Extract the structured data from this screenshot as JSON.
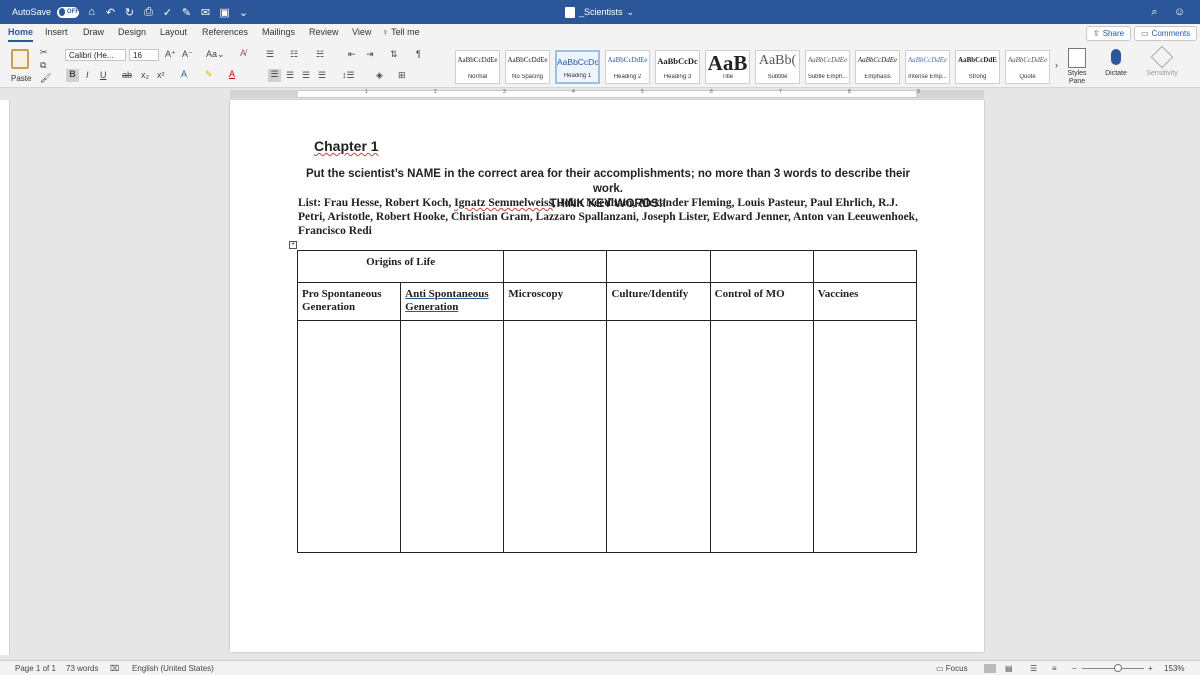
{
  "titlebar": {
    "autosave_label": "AutoSave",
    "autosave_state": "OFF",
    "document_title": "_Scientists"
  },
  "ribbon": {
    "tabs": [
      "Home",
      "Insert",
      "Draw",
      "Design",
      "Layout",
      "References",
      "Mailings",
      "Review",
      "View"
    ],
    "tell_me": "Tell me",
    "share": "Share",
    "comments": "Comments",
    "font_name": "Calibri (He...",
    "font_size": "16",
    "paste": "Paste",
    "styles": [
      {
        "sample": "AaBbCcDdEe",
        "name": "Normal"
      },
      {
        "sample": "AaBbCcDdEe",
        "name": "No Spacing"
      },
      {
        "sample": "AaBbCcDc",
        "name": "Heading 1"
      },
      {
        "sample": "AaBbCcDdEe",
        "name": "Heading 2"
      },
      {
        "sample": "AaBbCcDc",
        "name": "Heading 3"
      },
      {
        "sample": "AaB",
        "name": "Title"
      },
      {
        "sample": "AaBb(",
        "name": "Subtitle"
      },
      {
        "sample": "AaBbCcDdEe",
        "name": "Subtle Emph..."
      },
      {
        "sample": "AaBbCcDdEe",
        "name": "Emphasis"
      },
      {
        "sample": "AaBbCcDdEe",
        "name": "Intense Emp..."
      },
      {
        "sample": "AaBbCcDdE",
        "name": "Strong"
      },
      {
        "sample": "AaBbCcDdEe",
        "name": "Quote"
      }
    ],
    "styles_pane": "Styles Pane",
    "dictate": "Dictate",
    "sensitivity": "Sensitivity"
  },
  "ruler_numbers": [
    "1",
    "2",
    "3",
    "4",
    "5",
    "6",
    "7",
    "8",
    "9"
  ],
  "document": {
    "chapter": "Chapter 1",
    "instruction_line1": "Put the scientist’s NAME in the correct area for their accomplishments; no more than 3 words to describe their work.",
    "instruction_line2": "THINK KEY WORDS!!",
    "list_before": "List:  Frau Hesse, Robert Koch, ",
    "list_squiggle": "Ignatz Semmelweiss",
    "list_after": ", John Needham, Alexander Fleming, Louis Pasteur, Paul Ehrlich, R.J. Petri, Aristotle, Robert Hooke, Christian Gram, Lazzaro Spallanzani, Joseph Lister, Edward Jenner, Anton van Leeuwenhoek, Francisco Redi",
    "table": {
      "origins_header": "Origins of Life",
      "columns": [
        "Pro Spontaneous Generation",
        "Anti Spontaneous Generation",
        "Microscopy",
        "Culture/Identify",
        "Control of MO",
        "Vaccines"
      ]
    }
  },
  "status": {
    "page": "Page 1 of 1",
    "words": "73 words",
    "language": "English (United States)",
    "focus": "Focus",
    "zoom": "153%"
  }
}
